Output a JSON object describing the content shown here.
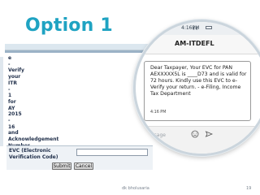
{
  "slide": {
    "title": "Option 1",
    "footer_author": "dk bholusaria",
    "page_number": "19"
  },
  "efiling_form": {
    "text_lines": [
      "e",
      "-",
      "Verify",
      "your",
      "ITR",
      "-",
      "1",
      "for",
      "AY",
      "2015",
      "-",
      "16",
      "and",
      "Acknowledgement",
      "Number"
    ],
    "cut_line": "500064120190715",
    "evc_label_line1": "EVC (Electronic",
    "evc_label_line2": "Verification Code)",
    "evc_input_value": "",
    "submit_label": "Submit",
    "cancel_label": "Cancel"
  },
  "phone": {
    "status_time": "4:16PM",
    "sender": "AM-ITDEFL",
    "sms_message": "Dear Taxpayer, Your EVC for PAN AEXXXXX5L is ____D73 and is valid for 72 hours. Kindly use this EVC to e-Verify your return. - e-Filing, Income Tax Department",
    "sms_time": "4:16 PM",
    "compose_placeholder": "message",
    "colors": {
      "accent_title": "#1fa3c2"
    }
  }
}
